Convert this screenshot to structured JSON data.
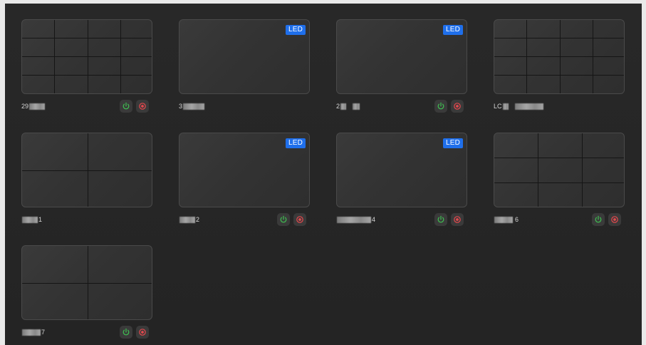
{
  "badge_text": "LED",
  "colors": {
    "background": "#262626",
    "card_border": "#4a4a4a",
    "led_badge": "#1f6feb",
    "power_green": "#3fb950",
    "stop_red": "#e5484d"
  },
  "icons": {
    "power": "power-icon",
    "stop": "stop-icon"
  },
  "cards": [
    {
      "name_prefix": "29",
      "name_suffix": "",
      "type": "grid",
      "led": false,
      "controls": true
    },
    {
      "name_prefix": "3",
      "name_suffix": "",
      "type": "blank",
      "led": true,
      "controls": false
    },
    {
      "name_prefix": "2",
      "name_suffix": "",
      "type": "blank",
      "led": true,
      "controls": true
    },
    {
      "name_prefix": "LC",
      "name_suffix": "",
      "type": "grid",
      "led": false,
      "controls": false
    },
    {
      "name_prefix": "",
      "name_suffix": "1",
      "type": "quad",
      "led": false,
      "controls": false
    },
    {
      "name_prefix": "",
      "name_suffix": "2",
      "type": "blank",
      "led": true,
      "controls": true
    },
    {
      "name_prefix": "",
      "name_suffix": "4",
      "type": "blank",
      "led": true,
      "controls": true
    },
    {
      "name_prefix": "",
      "name_suffix": "6",
      "type": "grid3",
      "led": false,
      "controls": true
    },
    {
      "name_prefix": "",
      "name_suffix": "7",
      "type": "quad",
      "led": false,
      "controls": true
    }
  ]
}
